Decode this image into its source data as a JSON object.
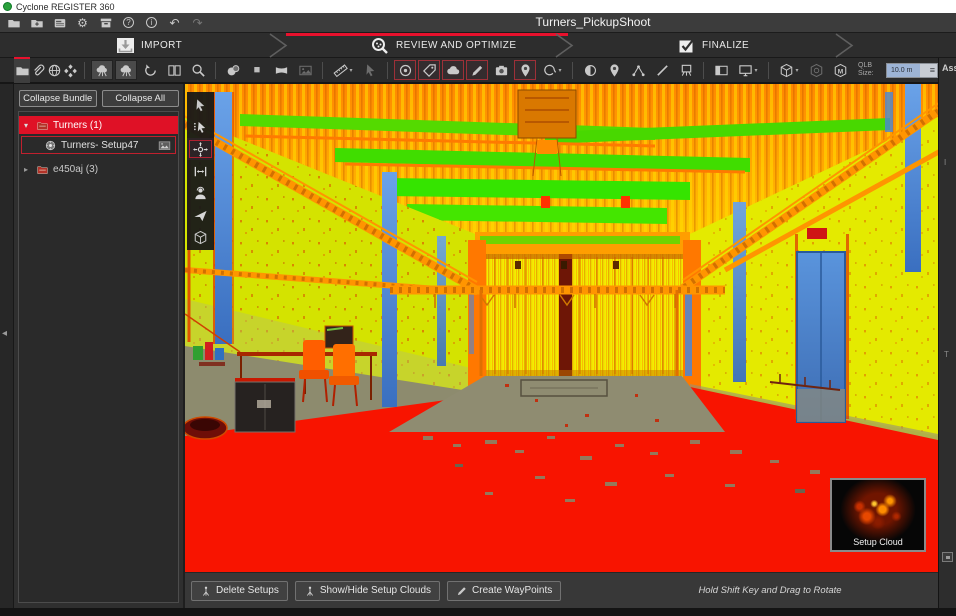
{
  "window": {
    "title": "Cyclone REGISTER 360",
    "app_icon": "cyclone-logo-icon"
  },
  "header": {
    "project_title": "Turners_PickupShoot",
    "icons": [
      "open-project-icon",
      "import-project-icon",
      "project-card-icon",
      "settings-gear-icon",
      "archive-box-icon",
      "help-icon",
      "about-info-icon",
      "undo-icon",
      "redo-icon"
    ]
  },
  "workflow": {
    "accent_color": "#e8112d",
    "stages": [
      {
        "label": "IMPORT",
        "icon": "import-tray-icon",
        "active": false
      },
      {
        "label": "REVIEW AND OPTIMIZE",
        "icon": "review-magnifier-icon",
        "active": true
      },
      {
        "label": "FINALIZE",
        "icon": "finalize-check-icon",
        "active": false
      }
    ]
  },
  "toolbar": {
    "tabs": [
      "project-folder-tab-icon",
      "links-paperclip-tab-icon",
      "bundle-globe-tab-icon",
      "cluster-tab-icon"
    ],
    "icons": [
      "setup-cloud-toggle-a-icon",
      "setup-cloud-toggle-b-icon",
      "rotate-view-icon",
      "split-panels-icon",
      "zoom-magnifier-icon",
      "blend-circles-icon",
      "fill-square-icon",
      "panorama-view-icon",
      "image-view-icon",
      "measure-tool-icon",
      "pick-cursor-icon",
      "add-target-icon",
      "add-tag-icon",
      "add-cloud-icon",
      "add-link-icon",
      "add-image-icon",
      "add-geotag-icon",
      "annotation-swirl-icon",
      "map-globe-icon",
      "waypoint-pin-icon",
      "traverse-graph-icon",
      "draw-line-icon",
      "survey-clipboard-icon",
      "side-panel-icon",
      "monitor-view-icon",
      "cube-view-icon",
      "cube-orbit-icon",
      "cube-measure-icon"
    ],
    "qlb_label": "QLB Size:",
    "qlb_value": "10.0 m"
  },
  "sidebar": {
    "collapse_bundle_label": "Collapse Bundle",
    "collapse_all_label": "Collapse All",
    "tree": [
      {
        "label": "Turners (1)",
        "state": "expanded",
        "selected": true
      },
      {
        "label": "Turners- Setup47",
        "state": "leaf",
        "outlined": true
      },
      {
        "label": "e450aj (3)",
        "state": "collapsed",
        "selected": false
      }
    ]
  },
  "viewport": {
    "nav_tools": [
      "select-cursor-icon",
      "pick-points-cursor-icon",
      "pan-view-icon",
      "measure-distance-icon",
      "person-view-icon",
      "fly-through-icon",
      "cube-3d-icon"
    ],
    "active_nav_tool": "pan-view-icon",
    "inset_caption": "Setup Cloud",
    "cloud_colors": {
      "floor": "#f81400",
      "walls": "#d6e400",
      "ceiling": "#ff9e00",
      "pipes": "#3ce000",
      "columns": "#4a86d8",
      "center_floor": "#8f8c71"
    }
  },
  "bottom_bar": {
    "buttons": [
      {
        "label": "Delete Setups",
        "icon": "setup-marker-icon"
      },
      {
        "label": "Show/Hide Setup Clouds",
        "icon": "setup-marker-icon"
      },
      {
        "label": "Create WayPoints",
        "icon": "pen-icon"
      }
    ],
    "hint": "Hold Shift Key and Drag to Rotate"
  },
  "right_panel": {
    "title": "Ass",
    "clipped_labels": [
      "I",
      "T"
    ]
  }
}
